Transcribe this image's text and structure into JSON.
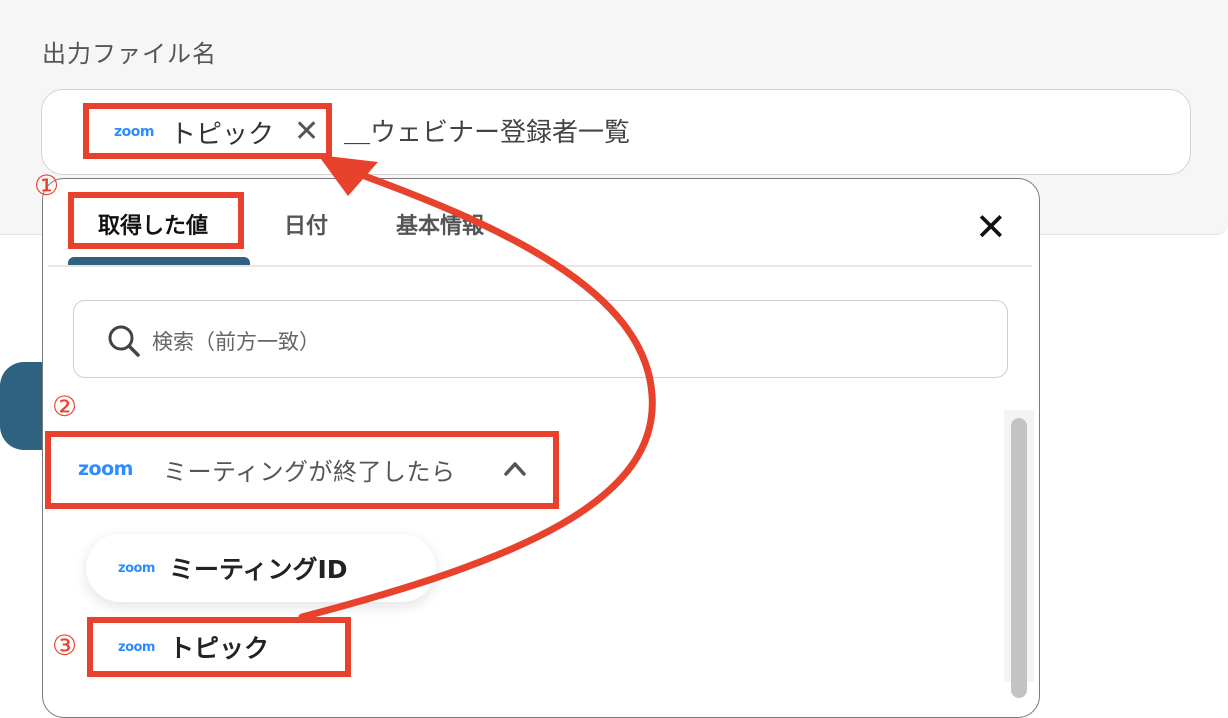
{
  "field": {
    "label": "出力ファイル名",
    "chip_logo": "zoom",
    "chip_label": "トピック",
    "chip_close_glyph": "✕",
    "suffix": "＿ウェビナー登録者一覧"
  },
  "popup": {
    "tabs": [
      {
        "label": "取得した値",
        "active": true
      },
      {
        "label": "日付",
        "active": false
      },
      {
        "label": "基本情報",
        "active": false
      }
    ],
    "close_glyph": "✕",
    "search": {
      "placeholder": "検索（前方一致）"
    },
    "group": {
      "logo": "zoom",
      "label": "ミーティングが終了したら",
      "expanded": true
    },
    "items": [
      {
        "logo": "zoom",
        "label": "ミーティングID"
      },
      {
        "logo": "zoom",
        "label": "トピック"
      }
    ]
  },
  "annotations": {
    "markers": [
      "①",
      "②",
      "③"
    ],
    "color": "#e8412c"
  },
  "colors": {
    "accent": "#2e6280",
    "zoom_blue": "#2d8cff",
    "annotation_red": "#e8412c"
  }
}
